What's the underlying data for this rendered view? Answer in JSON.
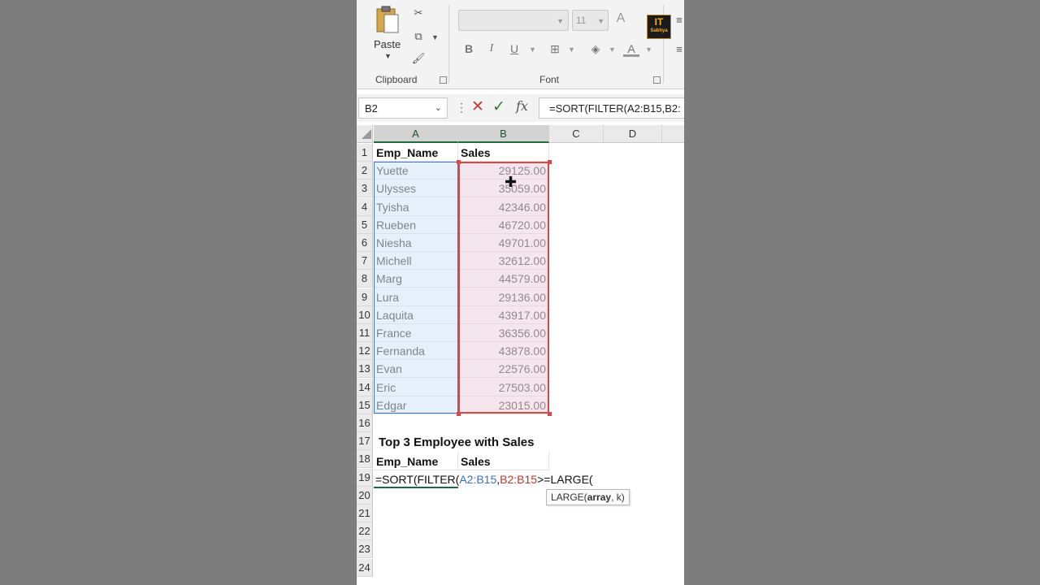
{
  "ribbon": {
    "paste_label": "Paste",
    "clipboard_label": "Clipboard",
    "font_label": "Font",
    "font_size": "11",
    "logo_text": "IT Sabhya"
  },
  "formula_bar": {
    "name_box": "B2",
    "formula": "=SORT(FILTER(A2:B15,B2:"
  },
  "columns": [
    "A",
    "B",
    "C",
    "D"
  ],
  "rows": [
    "1",
    "2",
    "3",
    "4",
    "5",
    "6",
    "7",
    "8",
    "9",
    "10",
    "11",
    "12",
    "13",
    "14",
    "15",
    "16",
    "17",
    "18",
    "19",
    "20",
    "21",
    "22",
    "23",
    "24"
  ],
  "table": {
    "header": {
      "name": "Emp_Name",
      "sales": "Sales"
    },
    "records": [
      {
        "name": "Yuette",
        "sales": "29125.00"
      },
      {
        "name": "Ulysses",
        "sales": "35059.00"
      },
      {
        "name": "Tyisha",
        "sales": "42346.00"
      },
      {
        "name": "Rueben",
        "sales": "46720.00"
      },
      {
        "name": "Niesha",
        "sales": "49701.00"
      },
      {
        "name": "Michell",
        "sales": "32612.00"
      },
      {
        "name": "Marg",
        "sales": "44579.00"
      },
      {
        "name": "Lura",
        "sales": "29136.00"
      },
      {
        "name": "Laquita",
        "sales": "43917.00"
      },
      {
        "name": "France",
        "sales": "36356.00"
      },
      {
        "name": "Fernanda",
        "sales": "43878.00"
      },
      {
        "name": "Evan",
        "sales": "22576.00"
      },
      {
        "name": "Eric",
        "sales": "27503.00"
      },
      {
        "name": "Edgar",
        "sales": "23015.00"
      }
    ]
  },
  "top3": {
    "title": "Top 3 Employee with Sales",
    "header_name": "Emp_Name",
    "header_sales": "Sales",
    "formula_prefix": "=SORT(FILTER(",
    "formula_ref_a": "A2:B15",
    "formula_comma": ",",
    "formula_ref_b": "B2:B15",
    "formula_suffix": ">=LARGE(",
    "tooltip_fn": "LARGE(",
    "tooltip_arg_bold": "array",
    "tooltip_rest": ", k)"
  },
  "colors": {
    "ref_a": "#3b6fd0",
    "ref_b": "#c0392b",
    "accent_green": "#1f6b3f"
  }
}
